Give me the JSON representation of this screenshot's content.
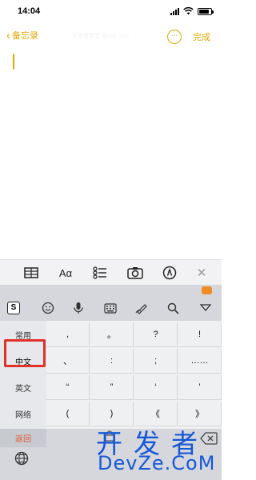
{
  "status_bar": {
    "time": "14:04",
    "battery_level": 0.85
  },
  "nav": {
    "back_label": "备忘录",
    "done_label": "完成",
    "more_glyph": "···",
    "watermark": "开发者学堂 devze.com"
  },
  "toolbar": {
    "items": [
      {
        "name": "table-icon"
      },
      {
        "name": "text-format-icon",
        "label": "Aα"
      },
      {
        "name": "checklist-icon"
      },
      {
        "name": "camera-icon"
      },
      {
        "name": "markup-pen-icon"
      },
      {
        "name": "close-icon",
        "label": "✕"
      }
    ]
  },
  "keyboard": {
    "candidate_icons": [
      "sogou-logo-icon",
      "emoji-icon",
      "microphone-icon",
      "keyboard-icon",
      "handwriting-icon",
      "search-icon",
      "collapse-icon"
    ],
    "sogou_label": "S",
    "categories": [
      "常用",
      "中文",
      "英文",
      "网络"
    ],
    "active_category": "中文",
    "symbols": [
      [
        ",",
        "。",
        "?",
        "!"
      ],
      [
        "、",
        ":",
        ";",
        "……"
      ],
      [
        "“",
        "”",
        "‘",
        "’"
      ],
      [
        "(",
        ")",
        "《",
        "》"
      ]
    ],
    "back_label": "返回",
    "lock_glyph": "🔒"
  },
  "watermark_logo": {
    "line1": "开发者",
    "line2": "DevZe.CoM"
  },
  "colors": {
    "accent": "#E0A800",
    "highlight": "#e0312b",
    "keyboard_bg": "#d5d7dc",
    "back_text": "#e4572e",
    "logo_blue": "#1658d6"
  }
}
